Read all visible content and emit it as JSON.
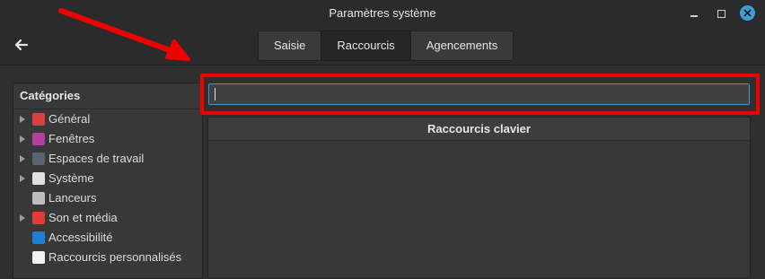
{
  "window": {
    "title": "Paramètres système",
    "controls": {
      "minimize": "minimize-icon",
      "maximize": "maximize-icon",
      "close": "close-icon"
    }
  },
  "header": {
    "back_icon": "back-arrow-icon",
    "tabs": [
      {
        "label": "Saisie",
        "active": false
      },
      {
        "label": "Raccourcis",
        "active": true
      },
      {
        "label": "Agencements",
        "active": false
      }
    ]
  },
  "sidebar": {
    "title": "Catégories",
    "items": [
      {
        "label": "Général",
        "expandable": true,
        "icon": "general-icon",
        "color": "#d94040"
      },
      {
        "label": "Fenêtres",
        "expandable": true,
        "icon": "windows-icon",
        "color": "#b03fa0"
      },
      {
        "label": "Espaces de travail",
        "expandable": true,
        "icon": "workspaces-icon",
        "color": "#5a6470"
      },
      {
        "label": "Système",
        "expandable": true,
        "icon": "system-icon",
        "color": "#e0e0e0"
      },
      {
        "label": "Lanceurs",
        "expandable": false,
        "icon": "launchers-icon",
        "color": "#bdbdbd"
      },
      {
        "label": "Son et média",
        "expandable": true,
        "icon": "sound-media-icon",
        "color": "#e53935"
      },
      {
        "label": "Accessibilité",
        "expandable": false,
        "icon": "accessibility-icon",
        "color": "#1e7fd8"
      },
      {
        "label": "Raccourcis personnalisés",
        "expandable": false,
        "icon": "custom-shortcuts-icon",
        "color": "#f2f2f2"
      }
    ]
  },
  "main": {
    "search": {
      "value": "",
      "placeholder": ""
    },
    "shortcuts_header": "Raccourcis clavier"
  },
  "annotation": {
    "color": "#f00000"
  },
  "colors": {
    "accent": "#3a9fd6",
    "focus_border": "#4a90c8"
  }
}
